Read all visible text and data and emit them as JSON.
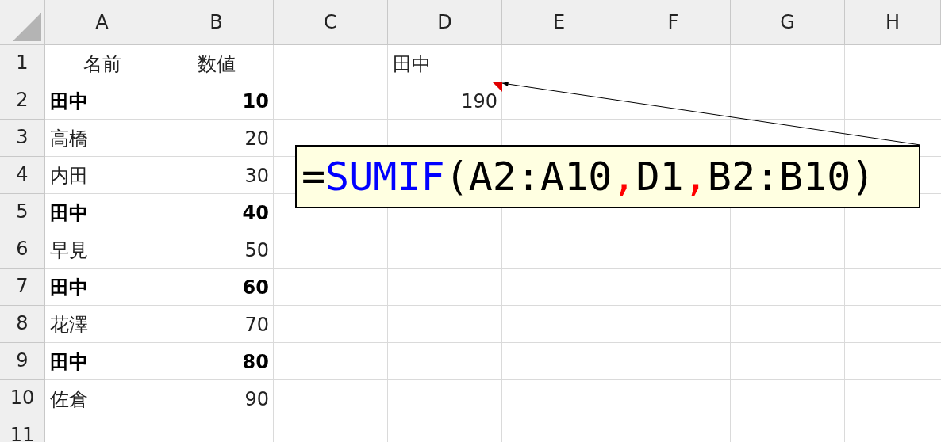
{
  "columns": [
    "A",
    "B",
    "C",
    "D",
    "E",
    "F",
    "G",
    "H"
  ],
  "rows": [
    {
      "header": "1",
      "cells": [
        {
          "text": "名前",
          "kind": "heading",
          "bold": false
        },
        {
          "text": "数値",
          "kind": "heading",
          "bold": false
        },
        null,
        {
          "text": "田中",
          "kind": "text",
          "bold": false
        },
        null,
        null,
        null,
        null
      ]
    },
    {
      "header": "2",
      "cells": [
        {
          "text": "田中",
          "kind": "text",
          "bold": true
        },
        {
          "text": "10",
          "kind": "number",
          "bold": true
        },
        null,
        {
          "text": "190",
          "kind": "number",
          "bold": false,
          "comment": true
        },
        null,
        null,
        null,
        null
      ]
    },
    {
      "header": "3",
      "cells": [
        {
          "text": "高橋",
          "kind": "text",
          "bold": false
        },
        {
          "text": "20",
          "kind": "number",
          "bold": false
        },
        null,
        null,
        null,
        null,
        null,
        null
      ]
    },
    {
      "header": "4",
      "cells": [
        {
          "text": "内田",
          "kind": "text",
          "bold": false
        },
        {
          "text": "30",
          "kind": "number",
          "bold": false
        },
        null,
        null,
        null,
        null,
        null,
        null
      ]
    },
    {
      "header": "5",
      "cells": [
        {
          "text": "田中",
          "kind": "text",
          "bold": true
        },
        {
          "text": "40",
          "kind": "number",
          "bold": true
        },
        null,
        null,
        null,
        null,
        null,
        null
      ]
    },
    {
      "header": "6",
      "cells": [
        {
          "text": "早見",
          "kind": "text",
          "bold": false
        },
        {
          "text": "50",
          "kind": "number",
          "bold": false
        },
        null,
        null,
        null,
        null,
        null,
        null
      ]
    },
    {
      "header": "7",
      "cells": [
        {
          "text": "田中",
          "kind": "text",
          "bold": true
        },
        {
          "text": "60",
          "kind": "number",
          "bold": true
        },
        null,
        null,
        null,
        null,
        null,
        null
      ]
    },
    {
      "header": "8",
      "cells": [
        {
          "text": "花澤",
          "kind": "text",
          "bold": false
        },
        {
          "text": "70",
          "kind": "number",
          "bold": false
        },
        null,
        null,
        null,
        null,
        null,
        null
      ]
    },
    {
      "header": "9",
      "cells": [
        {
          "text": "田中",
          "kind": "text",
          "bold": true
        },
        {
          "text": "80",
          "kind": "number",
          "bold": true
        },
        null,
        null,
        null,
        null,
        null,
        null
      ]
    },
    {
      "header": "10",
      "cells": [
        {
          "text": "佐倉",
          "kind": "text",
          "bold": false
        },
        {
          "text": "90",
          "kind": "number",
          "bold": false
        },
        null,
        null,
        null,
        null,
        null,
        null
      ]
    },
    {
      "header": "11",
      "cells": [
        null,
        null,
        null,
        null,
        null,
        null,
        null,
        null
      ]
    }
  ],
  "comment": {
    "segments": [
      {
        "text": "=",
        "color": "#000000"
      },
      {
        "text": "SUMIF",
        "color": "#0000ff"
      },
      {
        "text": "(A2:A10",
        "color": "#000000"
      },
      {
        "text": ",",
        "color": "#ff0000"
      },
      {
        "text": "D1",
        "color": "#000000"
      },
      {
        "text": ",",
        "color": "#ff0000"
      },
      {
        "text": "B2:B10)",
        "color": "#000000"
      }
    ]
  }
}
